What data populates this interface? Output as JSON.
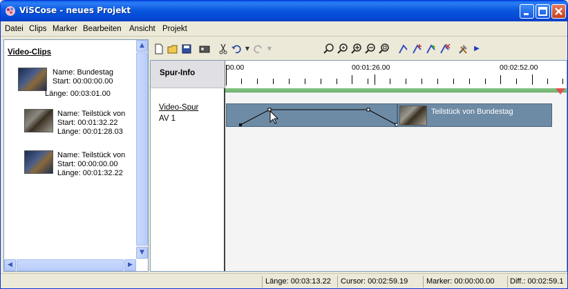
{
  "window": {
    "title": "ViSCose - neues Projekt"
  },
  "menu": [
    "Datei",
    "Clips",
    "Marker",
    "Bearbeiten",
    "Ansicht",
    "Projekt"
  ],
  "left_panel": {
    "heading": "Video-Clips",
    "clips": [
      {
        "name": "Name:  Bundestag",
        "start": "Start:   00:00:00.00",
        "length": "Länge: 00:03:01.00"
      },
      {
        "name": "Name:  Teilstück von",
        "start": "Start:   00:01:32.22",
        "length": "Länge: 00:01:28.03"
      },
      {
        "name": "Name:  Teilstück von",
        "start": "Start:   00:00:00.00",
        "length": "Länge: 00:01:32.22"
      }
    ]
  },
  "track": {
    "info_header": "Spur-Info",
    "name": "Video-Spur",
    "id": "AV 1",
    "ruler_labels": [
      "00.00",
      "00:01:26.00",
      "00:02:52.00"
    ],
    "clip_label": "Teilstück von Bundestag"
  },
  "status": {
    "length": "Länge: 00:03:13.22",
    "cursor": "Cursor: 00:02:59.19",
    "marker": "Marker: 00:00:00.00",
    "diff": "Diff.: 00:02:59.1"
  }
}
